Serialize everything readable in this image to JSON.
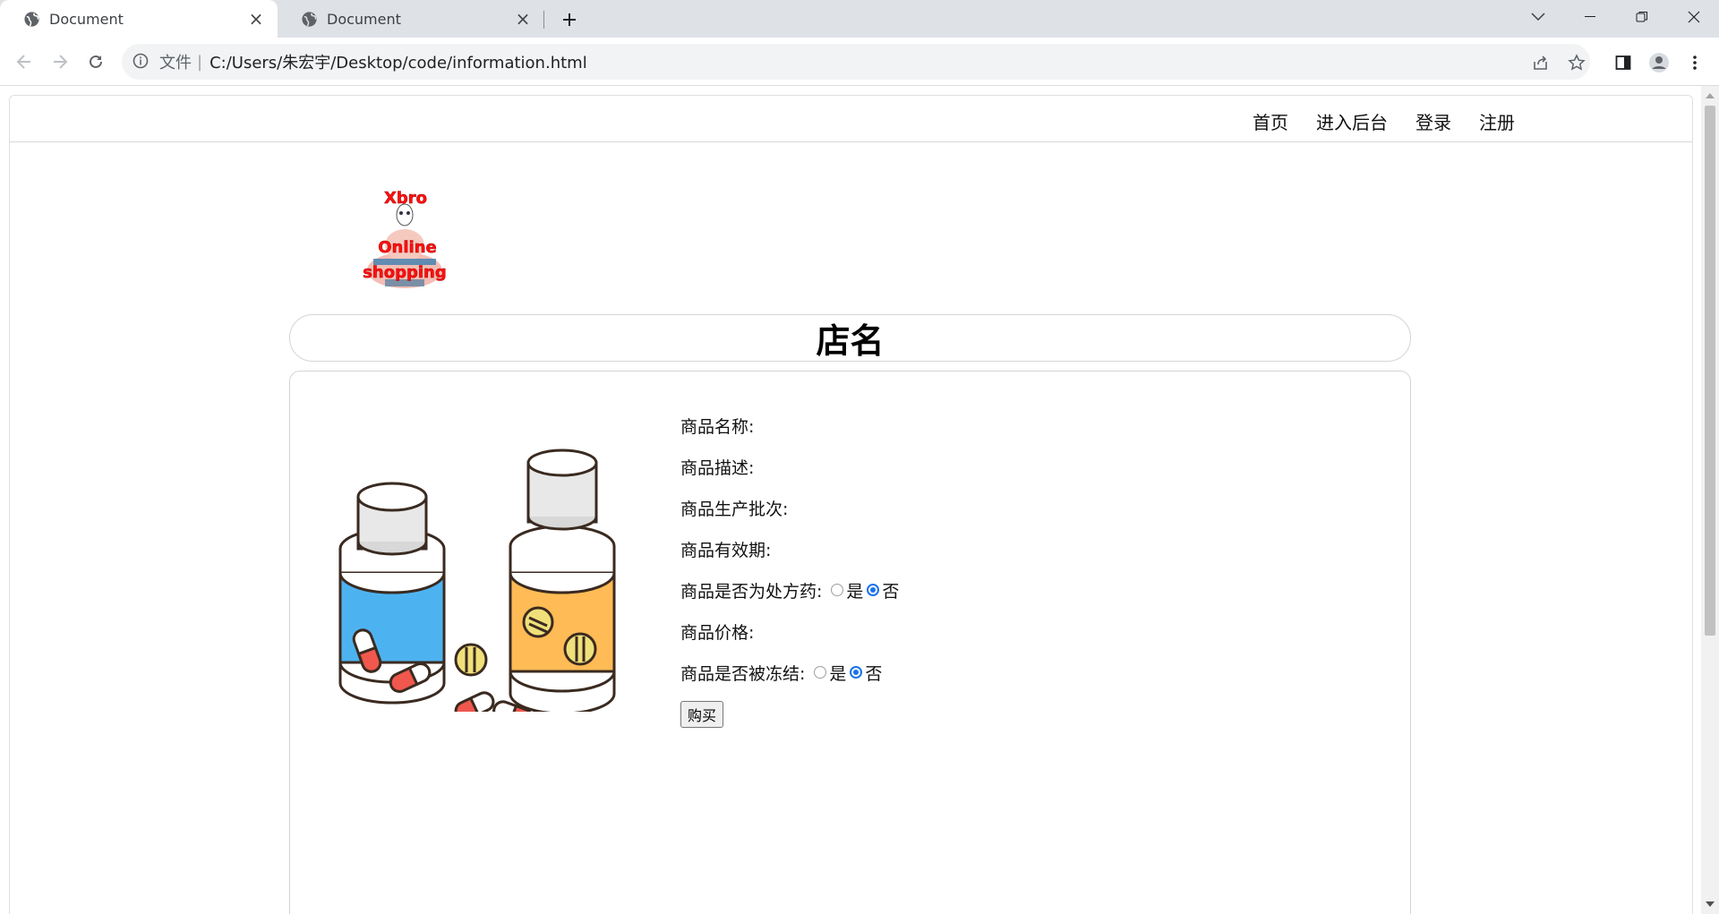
{
  "browser": {
    "tabs": [
      {
        "title": "Document",
        "active": true
      },
      {
        "title": "Document",
        "active": false
      }
    ],
    "address": {
      "scheme_label": "文件",
      "separator": "|",
      "url": "C:/Users/朱宏宇/Desktop/code/information.html"
    }
  },
  "nav": {
    "links": [
      "首页",
      "进入后台",
      "登录",
      "注册"
    ]
  },
  "logo": {
    "line1": "Xbro",
    "line2": "Online",
    "line3": "shopping"
  },
  "shop": {
    "name": "店名"
  },
  "product": {
    "name_label": "商品名称:",
    "description_label": "商品描述:",
    "batch_label": "商品生产批次:",
    "expiry_label": "商品有效期:",
    "prescription": {
      "label": "商品是否为处方药:",
      "yes": "是",
      "no": "否",
      "selected": "no"
    },
    "price_label": "商品价格:",
    "frozen": {
      "label": "商品是否被冻结:",
      "yes": "是",
      "no": "否",
      "selected": "no"
    },
    "buy_label": "购买"
  },
  "colors": {
    "accent": "#1a73e8",
    "bottle_blue": "#4db3f0",
    "bottle_orange": "#ffbb55",
    "pill_red": "#f0574d",
    "logo_red": "#ff1010"
  }
}
